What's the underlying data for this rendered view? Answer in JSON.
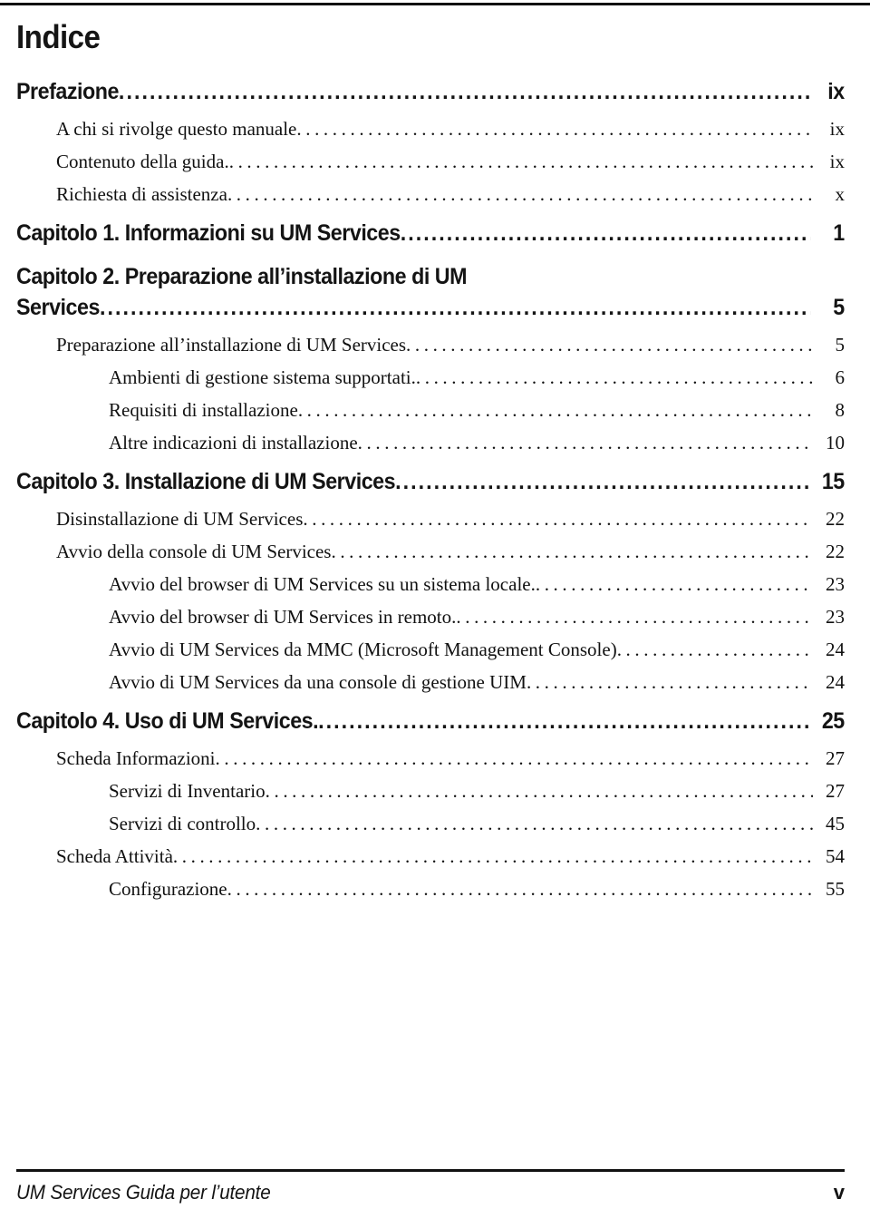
{
  "document": {
    "title": "Indice"
  },
  "toc": {
    "entries": [
      {
        "level": "chapter",
        "label": "Prefazione",
        "page": "ix",
        "wraps": false
      },
      {
        "level": "1",
        "label": "A chi si rivolge questo manuale",
        "page": "ix"
      },
      {
        "level": "1",
        "label": "Contenuto della guida.",
        "page": "ix"
      },
      {
        "level": "1",
        "label": "Richiesta di assistenza",
        "page": "x"
      },
      {
        "level": "chapter",
        "label": "Capitolo 1. Informazioni su UM Services",
        "page": "1",
        "wraps": false
      },
      {
        "level": "chapter",
        "label": "Capitolo 2. Preparazione all’installazione di UM",
        "label2": "Services",
        "page": "5",
        "wraps": true
      },
      {
        "level": "1",
        "label": "Preparazione all’installazione di UM Services",
        "page": "5"
      },
      {
        "level": "2",
        "label": "Ambienti di gestione sistema supportati.",
        "page": "6"
      },
      {
        "level": "2",
        "label": "Requisiti di installazione",
        "page": "8"
      },
      {
        "level": "2",
        "label": "Altre indicazioni di installazione",
        "page": "10"
      },
      {
        "level": "chapter",
        "label": "Capitolo 3. Installazione di UM Services",
        "page": "15",
        "wraps": false
      },
      {
        "level": "1",
        "label": "Disinstallazione di UM Services",
        "page": "22"
      },
      {
        "level": "1",
        "label": "Avvio della console di UM Services",
        "page": "22"
      },
      {
        "level": "2",
        "label": "Avvio del browser di UM Services su un sistema locale.",
        "page": "23"
      },
      {
        "level": "2",
        "label": "Avvio del browser di UM Services in remoto.",
        "page": "23"
      },
      {
        "level": "2",
        "label": "Avvio di UM Services da MMC (Microsoft Management Console)",
        "page": "24"
      },
      {
        "level": "2",
        "label": "Avvio di UM Services da una console di gestione UIM",
        "page": "24"
      },
      {
        "level": "chapter",
        "label": "Capitolo 4. Uso di UM Services.",
        "page": "25",
        "wraps": false
      },
      {
        "level": "1",
        "label": "Scheda Informazioni",
        "page": "27"
      },
      {
        "level": "2",
        "label": "Servizi di Inventario",
        "page": "27"
      },
      {
        "level": "2",
        "label": "Servizi di controllo",
        "page": "45"
      },
      {
        "level": "1",
        "label": "Scheda Attività",
        "page": "54"
      },
      {
        "level": "2",
        "label": "Configurazione",
        "page": "55"
      }
    ]
  },
  "footer": {
    "left": "UM Services Guida per l’utente",
    "right": "v"
  }
}
